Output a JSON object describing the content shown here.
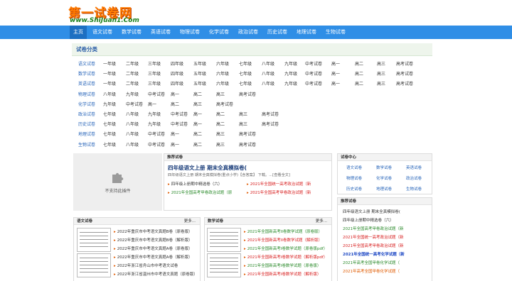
{
  "header": {
    "logo_main": "第一试卷网",
    "logo_sub": "www.ShiJuan1.Com"
  },
  "nav": {
    "items": [
      "主页",
      "语文试卷",
      "数学试卷",
      "英语试卷",
      "物理试卷",
      "化学试卷",
      "政治试卷",
      "历史试卷",
      "地理试卷",
      "生物试卷"
    ]
  },
  "categories": {
    "title": "试卷分类",
    "rows": [
      {
        "label": "语文试卷",
        "links": [
          "一年级",
          "二年级",
          "三年级",
          "四年级",
          "五年级",
          "六年级",
          "七年级",
          "八年级",
          "九年级",
          "中考试卷",
          "高一",
          "高二",
          "高三",
          "高考试卷"
        ]
      },
      {
        "label": "数学试卷",
        "links": [
          "一年级",
          "二年级",
          "三年级",
          "四年级",
          "五年级",
          "六年级",
          "七年级",
          "八年级",
          "九年级",
          "中考试卷",
          "高一",
          "高二",
          "高三",
          "高考试卷"
        ]
      },
      {
        "label": "英语试卷",
        "links": [
          "一年级",
          "二年级",
          "三年级",
          "四年级",
          "五年级",
          "六年级",
          "七年级",
          "八年级",
          "九年级",
          "中考试卷",
          "高一",
          "高二",
          "高三",
          "高考试卷"
        ]
      },
      {
        "label": "物理试卷",
        "links": [
          "八年级",
          "九年级",
          "中考试卷",
          "高一",
          "高二",
          "高三",
          "高考试卷"
        ]
      },
      {
        "label": "化学试卷",
        "links": [
          "九年级",
          "中考试卷",
          "高一",
          "高二",
          "高三",
          "高考试卷"
        ]
      },
      {
        "label": "政治试卷",
        "links": [
          "七年级",
          "八年级",
          "九年级",
          "中考试卷",
          "高一",
          "高二",
          "高三",
          "高考试卷"
        ]
      },
      {
        "label": "历史试卷",
        "links": [
          "七年级",
          "八年级",
          "九年级",
          "中考试卷",
          "高一",
          "高二",
          "高三",
          "高考试卷"
        ]
      },
      {
        "label": "地理试卷",
        "links": [
          "七年级",
          "八年级",
          "中考试卷",
          "高一",
          "高二",
          "高三",
          "高考试卷"
        ]
      },
      {
        "label": "生物试卷",
        "links": [
          "七年级",
          "八年级",
          "中考试卷",
          "高一",
          "高二",
          "高三",
          "高考试卷"
        ]
      }
    ]
  },
  "plugin": {
    "text": "不支持此插件",
    "icon": "puzzle-icon"
  },
  "recommend": {
    "head": "推荐试卷",
    "headline": "四年级语文上册 期末全真模拟卷(",
    "desc": "四年级语文上册 期末全真模拟卷(重点小学)【含答案】 下载。...[查看全文]",
    "links_left": [
      "四年级上册期中精选卷（六）",
      "2021年全国高考甲卷政治试题（原"
    ],
    "links_right": [
      "2021年全国统一高考政治试题（新",
      "2021年全国高考甲卷政治试题（新"
    ]
  },
  "center": {
    "head": "试卷中心",
    "links": [
      "语文试卷",
      "数学试卷",
      "英语试卷",
      "物理试卷",
      "化学试卷",
      "政治试卷",
      "历史试卷",
      "地理试卷",
      "生物试卷"
    ]
  },
  "side_rec": {
    "head": "推荐试卷",
    "items": [
      "四年级语文上册 期末全真模拟卷(",
      "四年级上册期中精选卷（六）",
      "2021年全国高考甲卷政治试题（新",
      "2021年全国统一高考政治试题（新",
      "2021年全国高考甲卷政治试题（新",
      "2021年全国统一高考化学试题（新",
      "2021年高考全国甲卷化学试题（",
      "2021年高考全国甲卷化学试题（"
    ]
  },
  "chinese": {
    "head": "语文试卷",
    "more": "更多...",
    "items": [
      "2022年重庆市中考语文真题B卷（原卷版）",
      "2022年重庆市中考语文真题B卷（解析版）",
      "2022年重庆市中考语文真题A卷（原卷版）",
      "2022年重庆市中考语文真题A卷（解析版）",
      "2022年浙江省舟山市中考语文试卷",
      "2022年浙江省温州市中考语文真题（原卷版）"
    ]
  },
  "math": {
    "head": "数学试卷",
    "more": "更多...",
    "items": [
      "2021年全国新高考II卷数学试题（原卷版）",
      "2021年全国新高考II卷数学试题（解析版）",
      "2021年全国新高考I卷数学试题（原卷版pdf）",
      "2021年全国新高考I卷数学试题（解析版pdf）",
      "2021年全国新高考I卷数学试题（原卷版）",
      "2021年全国新高考I卷数学试题（解析版）"
    ]
  },
  "colors": {
    "nav_bg": "#2f8ee6",
    "accent_blue": "#2563b9",
    "logo_orange": "#ff7a00"
  }
}
